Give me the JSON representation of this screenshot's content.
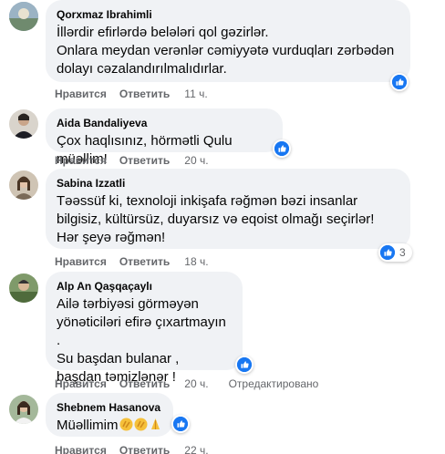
{
  "comments": [
    {
      "author": "Qorxmaz Ibrahimli",
      "text": "İllərdir efirlərdə belələri qol gəzirlər.\nOnlara meydan verənlər cəmiyyətə vurduqları zərbədən dolayı cəzalandırılmalıdırlar.",
      "like_label": "Нравится",
      "reply_label": "Ответить",
      "time": "11 ч."
    },
    {
      "author": "Aida Bandaliyeva",
      "text": "Çox haqlısınız, hörmətli Qulu müəllim!",
      "like_label": "Нравится",
      "reply_label": "Ответить",
      "time": "20 ч."
    },
    {
      "author": "Sabina Izzatli",
      "text": "Təəssüf ki, texnoloji inkişafa rəğmən bəzi insanlar bilgisiz, kültürsüz, duyarsız və eqoist olmağı seçirlər! Hər şeyə rəğmən!",
      "like_label": "Нравится",
      "reply_label": "Ответить",
      "time": "18 ч.",
      "reaction_count": "3"
    },
    {
      "author": "Alp An Qaşqaçaylı",
      "text": "Ailə tərbiyəsi görməyən\nyönəticiləri efirə çıxartmayın .\nSu başdan bulanar ,\n başdan təmizlənər !",
      "like_label": "Нравится",
      "reply_label": "Ответить",
      "time": "20 ч.",
      "edited": "Отредактировано"
    },
    {
      "author": "Shebnem Hasanova",
      "text": "Müəllimim",
      "like_label": "Нравится",
      "reply_label": "Ответить",
      "time": "22 ч."
    }
  ],
  "colors": {
    "bubble_bg": "#f0f2f5",
    "like_blue": "#1877f2",
    "meta_gray": "#65676b"
  },
  "icons": {
    "like": "thumbs-up-icon",
    "emoji_clap": "clapping-hands-emoji",
    "emoji_pray": "folded-hands-emoji"
  }
}
